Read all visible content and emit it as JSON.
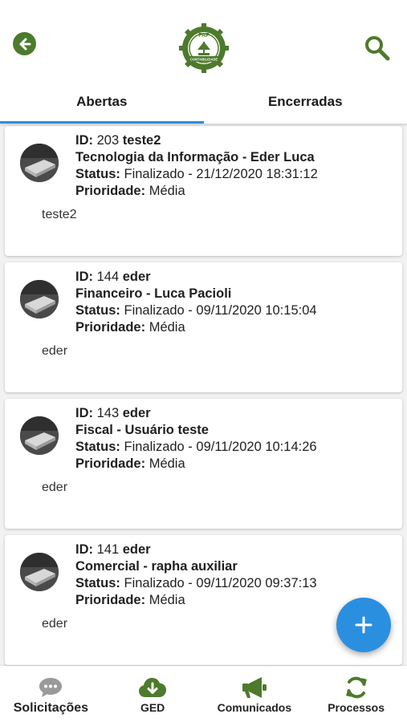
{
  "header": {
    "back_icon": "arrow-left-circle-icon",
    "logo_text_top": "FAP",
    "logo_text_bottom": "CONTABILIDADE",
    "search_icon": "search-icon"
  },
  "tabs": [
    {
      "label": "Abertas",
      "active": true
    },
    {
      "label": "Encerradas",
      "active": false
    }
  ],
  "labels": {
    "id": "ID:",
    "status": "Status:",
    "priority": "Prioridade:"
  },
  "tickets": [
    {
      "id": "203",
      "title": "teste2",
      "department": "Tecnologia da Informação - Eder Luca",
      "status": "Finalizado - 21/12/2020 18:31:12",
      "priority": "Média",
      "description": "teste2"
    },
    {
      "id": "144",
      "title": "eder",
      "department": "Financeiro - Luca Pacioli",
      "status": "Finalizado - 09/11/2020 10:15:04",
      "priority": "Média",
      "description": "eder"
    },
    {
      "id": "143",
      "title": "eder",
      "department": "Fiscal - Usuário teste",
      "status": "Finalizado - 09/11/2020 10:14:26",
      "priority": "Média",
      "description": "eder"
    },
    {
      "id": "141",
      "title": "eder",
      "department": "Comercial - rapha auxiliar",
      "status": "Finalizado - 09/11/2020 09:37:13",
      "priority": "Média",
      "description": "eder"
    }
  ],
  "fab": {
    "icon": "plus-icon"
  },
  "bottom_nav": [
    {
      "label": "Solicitações",
      "icon": "chat-bubble-icon",
      "active": true
    },
    {
      "label": "GED",
      "icon": "cloud-download-icon",
      "active": false
    },
    {
      "label": "Comunicados",
      "icon": "megaphone-icon",
      "active": false
    },
    {
      "label": "Processos",
      "icon": "refresh-icon",
      "active": false
    }
  ],
  "colors": {
    "brand_green": "#4d7a2c",
    "accent_blue": "#2b8fe0",
    "inactive_gray": "#9a9a9a"
  }
}
